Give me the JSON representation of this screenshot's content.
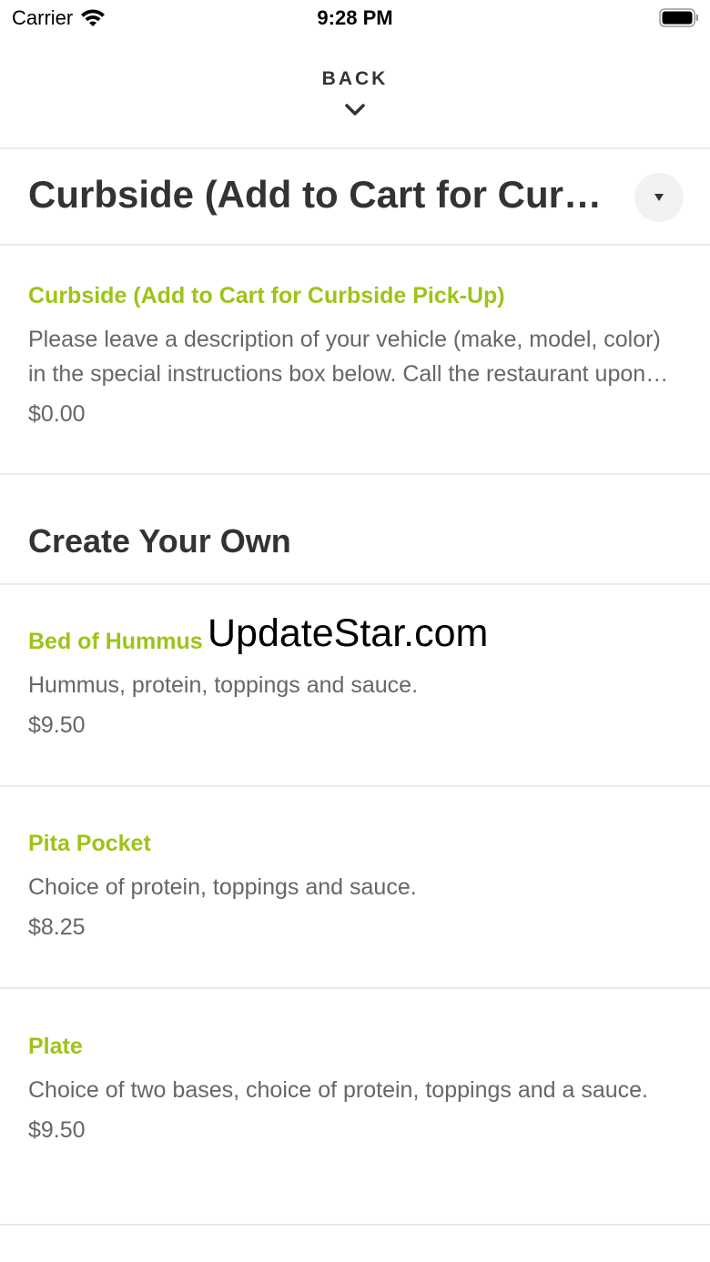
{
  "status_bar": {
    "carrier": "Carrier",
    "time": "9:28 PM"
  },
  "nav": {
    "back_label": "BACK"
  },
  "category": {
    "title": "Curbside (Add to Cart for Curbside Pick-Up)"
  },
  "curbside_item": {
    "name": "Curbside (Add to Cart for Curbside Pick-Up)",
    "description": "Please leave a description of your vehicle (make, model, color) in the special instructions box below. Call the restaurant upon arrival.",
    "price": "$0.00"
  },
  "section": {
    "heading": "Create Your Own"
  },
  "items": [
    {
      "name": "Bed of Hummus",
      "description": "Hummus, protein, toppings and sauce.",
      "price": "$9.50"
    },
    {
      "name": "Pita Pocket",
      "description": "Choice of protein, toppings and sauce.",
      "price": "$8.25"
    },
    {
      "name": "Plate",
      "description": "Choice of two bases, choice of protein, toppings and a sauce.",
      "price": "$9.50"
    }
  ],
  "watermark": "UpdateStar.com",
  "colors": {
    "accent": "#9cc418",
    "title_text": "#333333",
    "body_text": "#666666",
    "divider": "#ebebeb"
  },
  "icons": {
    "wifi": "wifi-icon",
    "battery": "battery-icon",
    "back": "chevron-down-icon",
    "dropdown": "caret-down-icon"
  }
}
